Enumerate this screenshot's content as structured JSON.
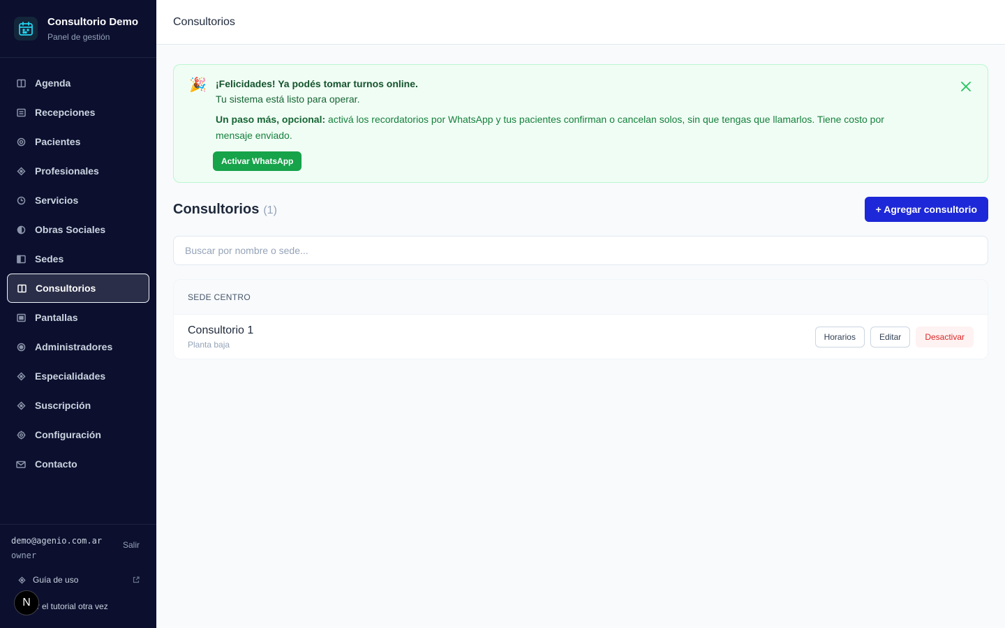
{
  "brand": {
    "title": "Consultorio Demo",
    "subtitle": "Panel de gestión",
    "logo_icon": "calendar-icon"
  },
  "sidebar": {
    "items": [
      {
        "label": "Agenda",
        "icon": "columns-icon"
      },
      {
        "label": "Recepciones",
        "icon": "list-icon"
      },
      {
        "label": "Pacientes",
        "icon": "circle-icon"
      },
      {
        "label": "Profesionales",
        "icon": "diamond-icon"
      },
      {
        "label": "Servicios",
        "icon": "clock-icon"
      },
      {
        "label": "Obras Sociales",
        "icon": "half-circle-icon"
      },
      {
        "label": "Sedes",
        "icon": "sidebar-icon"
      },
      {
        "label": "Consultorios",
        "icon": "columns-icon",
        "active": true
      },
      {
        "label": "Pantallas",
        "icon": "screen-icon"
      },
      {
        "label": "Administradores",
        "icon": "circle-icon"
      },
      {
        "label": "Especialidades",
        "icon": "diamond-icon"
      },
      {
        "label": "Suscripción",
        "icon": "diamond-icon"
      },
      {
        "label": "Configuración",
        "icon": "gear-icon"
      },
      {
        "label": "Contacto",
        "icon": "mail-icon"
      }
    ]
  },
  "user": {
    "email": "demo@agenio.com.ar",
    "role": "owner",
    "logout_label": "Salir"
  },
  "footer": {
    "guide_label": "Guía de uso",
    "tutorial_label": "er el tutorial otra vez",
    "badge_letter": "N"
  },
  "topbar": {
    "title": "Consultorios"
  },
  "banner": {
    "emoji": "🎉",
    "title": "¡Felicidades! Ya podés tomar turnos online.",
    "subtitle": "Tu sistema está listo para operar.",
    "text_strong": "Un paso más, opcional:",
    "text_rest": " activá los recordatorios por WhatsApp y tus pacientes confirman o cancelan solos, sin que tengas que llamarlos. Tiene costo por mensaje enviado.",
    "button_label": "Activar WhatsApp",
    "accent_color": "#16a34a"
  },
  "section": {
    "title": "Consultorios",
    "count": "(1)",
    "add_button_label": "+ Agregar consultorio",
    "accent_color": "#1d28d8"
  },
  "search": {
    "placeholder": "Buscar por nombre o sede...",
    "value": ""
  },
  "groups": [
    {
      "header": "SEDE CENTRO",
      "rows": [
        {
          "name": "Consultorio 1",
          "subtitle": "Planta baja",
          "actions": {
            "schedule": "Horarios",
            "edit": "Editar",
            "deactivate": "Desactivar"
          }
        }
      ]
    }
  ]
}
